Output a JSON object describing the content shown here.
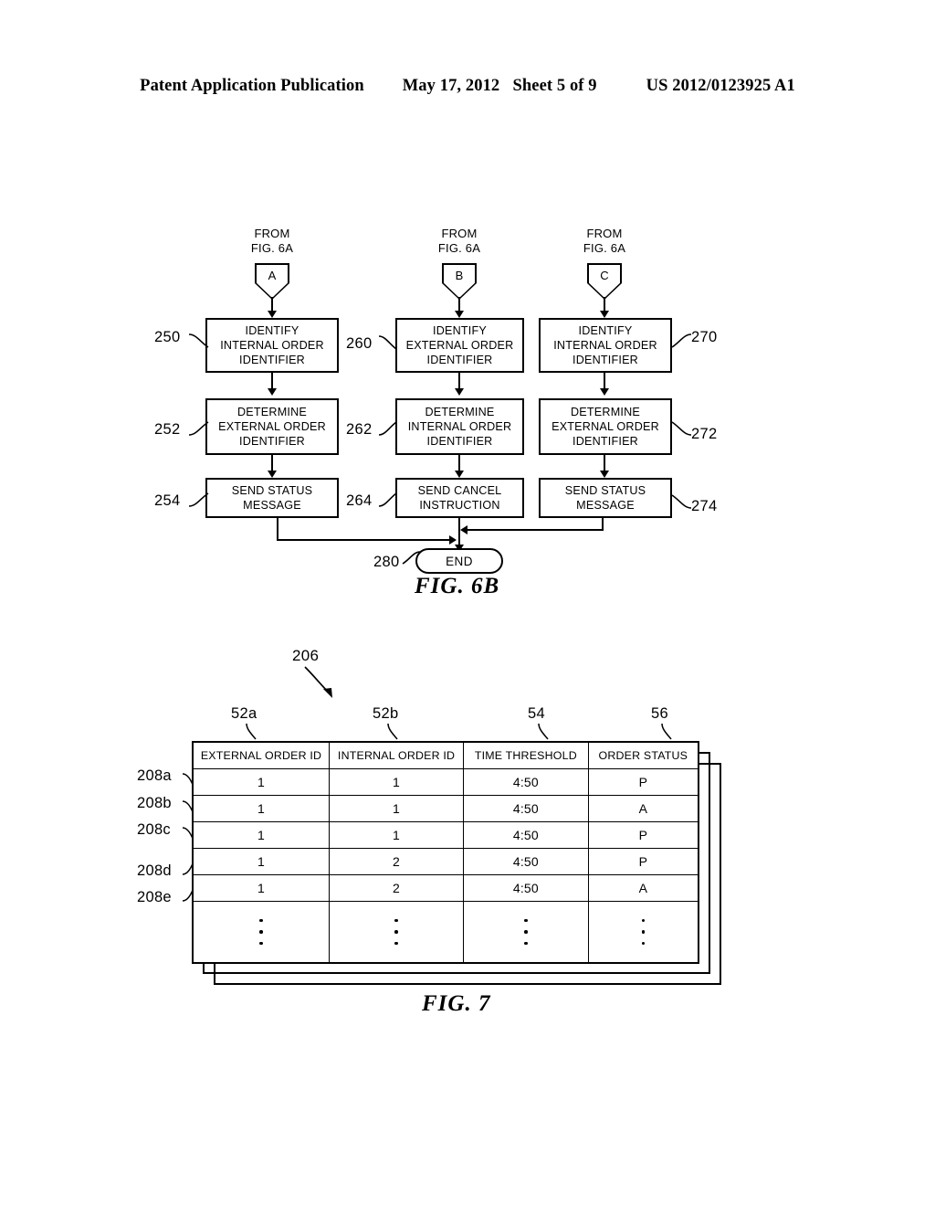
{
  "header": {
    "publication": "Patent Application Publication",
    "date": "May 17, 2012",
    "sheet": "Sheet 5 of 9",
    "docnum": "US 2012/0123925 A1"
  },
  "fig6b": {
    "caption": "FIG. 6B",
    "columns": [
      {
        "from_label": "FROM\nFIG. 6A",
        "connector": "A",
        "steps": [
          {
            "ref": "250",
            "text": "IDENTIFY\nINTERNAL ORDER\nIDENTIFIER"
          },
          {
            "ref": "252",
            "text": "DETERMINE\nEXTERNAL ORDER\nIDENTIFIER"
          },
          {
            "ref": "254",
            "text": "SEND STATUS\nMESSAGE"
          }
        ]
      },
      {
        "from_label": "FROM\nFIG. 6A",
        "connector": "B",
        "steps": [
          {
            "ref": "260",
            "text": "IDENTIFY\nEXTERNAL ORDER\nIDENTIFIER"
          },
          {
            "ref": "262",
            "text": "DETERMINE\nINTERNAL ORDER\nIDENTIFIER"
          },
          {
            "ref": "264",
            "text": "SEND CANCEL\nINSTRUCTION"
          }
        ]
      },
      {
        "from_label": "FROM\nFIG. 6A",
        "connector": "C",
        "steps": [
          {
            "ref": "270",
            "text": "IDENTIFY\nINTERNAL ORDER\nIDENTIFIER"
          },
          {
            "ref": "272",
            "text": "DETERMINE\nEXTERNAL ORDER\nIDENTIFIER"
          },
          {
            "ref": "274",
            "text": "SEND STATUS\nMESSAGE"
          }
        ]
      }
    ],
    "end": {
      "ref": "280",
      "label": "END"
    }
  },
  "fig7": {
    "caption": "FIG. 7",
    "table_ref": "206",
    "column_refs": [
      "52a",
      "52b",
      "54",
      "56"
    ],
    "row_refs": [
      "208a",
      "208b",
      "208c",
      "208d",
      "208e"
    ],
    "headers": [
      "EXTERNAL ORDER ID",
      "INTERNAL ORDER ID",
      "TIME THRESHOLD",
      "ORDER STATUS"
    ],
    "rows": [
      [
        "1",
        "1",
        "4:50",
        "P"
      ],
      [
        "1",
        "1",
        "4:50",
        "A"
      ],
      [
        "1",
        "1",
        "4:50",
        "P"
      ],
      [
        "1",
        "2",
        "4:50",
        "P"
      ],
      [
        "1",
        "2",
        "4:50",
        "A"
      ]
    ],
    "continuation": "⋮"
  }
}
